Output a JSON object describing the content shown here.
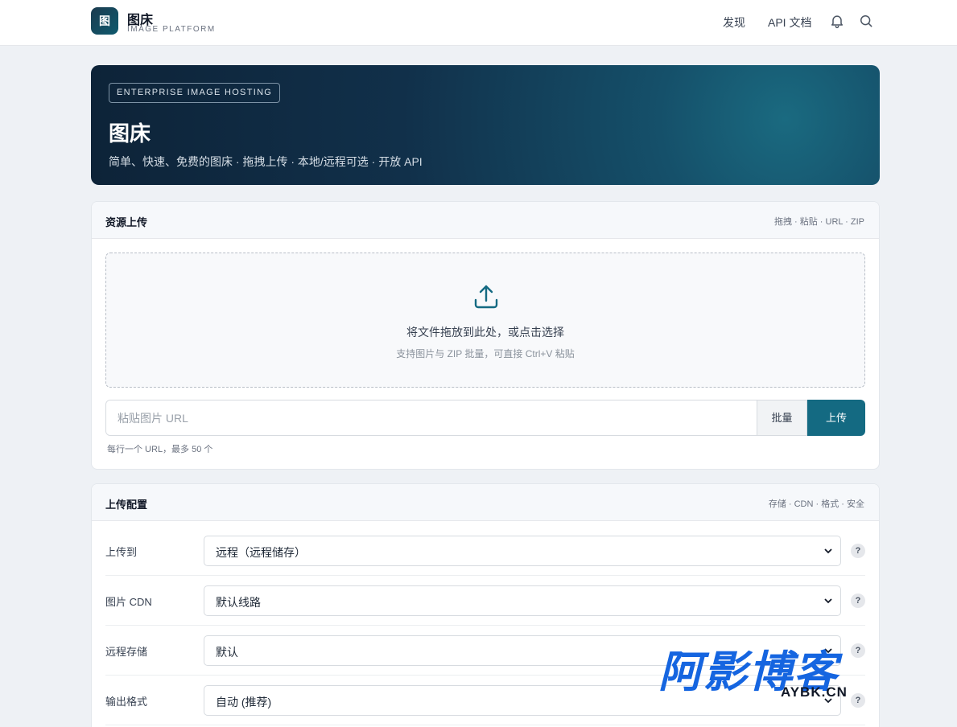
{
  "brand": {
    "logo_char": "图",
    "title": "图床",
    "subtitle": "IMAGE PLATFORM"
  },
  "nav": {
    "discover": "发现",
    "api_docs": "API 文档",
    "icons": [
      "bell-icon",
      "search-icon"
    ]
  },
  "hero": {
    "badge": "ENTERPRISE IMAGE HOSTING",
    "title": "图床",
    "subtitle": "简单、快速、免费的图床 · 拖拽上传 · 本地/远程可选 · 开放 API"
  },
  "upload_card": {
    "title": "资源上传",
    "meta": "拖拽 · 粘贴 · URL · ZIP",
    "drop_main": "将文件拖放到此处，或点击选择",
    "drop_sub": "支持图片与 ZIP 批量，可直接 Ctrl+V 粘贴",
    "url_placeholder": "粘贴图片 URL",
    "batch_label": "批量",
    "upload_label": "上传",
    "hint": "每行一个 URL，最多 50 个"
  },
  "config_card": {
    "title": "上传配置",
    "meta": "存储 · CDN · 格式 · 安全",
    "rows": [
      {
        "label": "上传到",
        "value": "远程（远程储存）",
        "help": "?"
      },
      {
        "label": "图片 CDN",
        "value": "默认线路",
        "help": "?"
      },
      {
        "label": "远程存储",
        "value": "默认",
        "help": "?"
      },
      {
        "label": "输出格式",
        "value": "自动 (推荐)",
        "help": "?"
      }
    ]
  },
  "watermark": {
    "main": "阿影博客",
    "sub": "AYBK.CN"
  },
  "colors": {
    "accent": "#146a82",
    "hero_dark": "#0d2338",
    "watermark_blue": "#1565e0"
  }
}
